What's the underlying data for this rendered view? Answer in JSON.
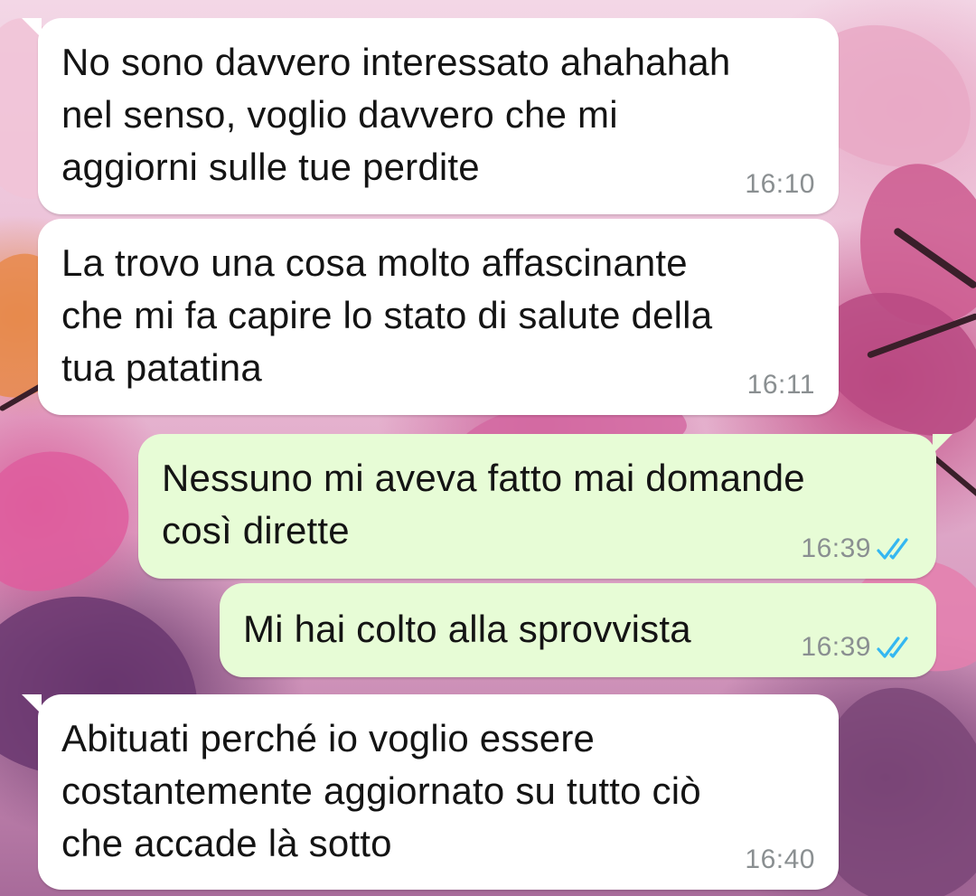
{
  "messages": [
    {
      "direction": "incoming",
      "text": "No sono davvero interessato ahahahah\nnel senso, voglio davvero che mi\naggiorni sulle tue perdite",
      "time": "16:10"
    },
    {
      "direction": "incoming",
      "text": "La trovo una cosa molto affascinante\nche mi fa capire lo stato di salute della\ntua patatina",
      "time": "16:11"
    },
    {
      "direction": "outgoing",
      "text": "Nessuno mi aveva fatto mai domande\ncosì dirette",
      "time": "16:39",
      "status_icon": "double-check-read-icon"
    },
    {
      "direction": "outgoing",
      "text": "Mi hai colto alla sprovvista",
      "time": "16:39",
      "status_icon": "double-check-read-icon"
    },
    {
      "direction": "incoming",
      "text": "Abituati perché io voglio essere\ncostantemente aggiornato su tutto ciò\nche accade là sotto",
      "time": "16:40"
    }
  ],
  "colors": {
    "incoming_bubble": "#ffffff",
    "outgoing_bubble": "#e7fcd6",
    "timestamp": "#8a8f91",
    "read_ticks": "#34b7f1",
    "message_text": "#141414"
  }
}
